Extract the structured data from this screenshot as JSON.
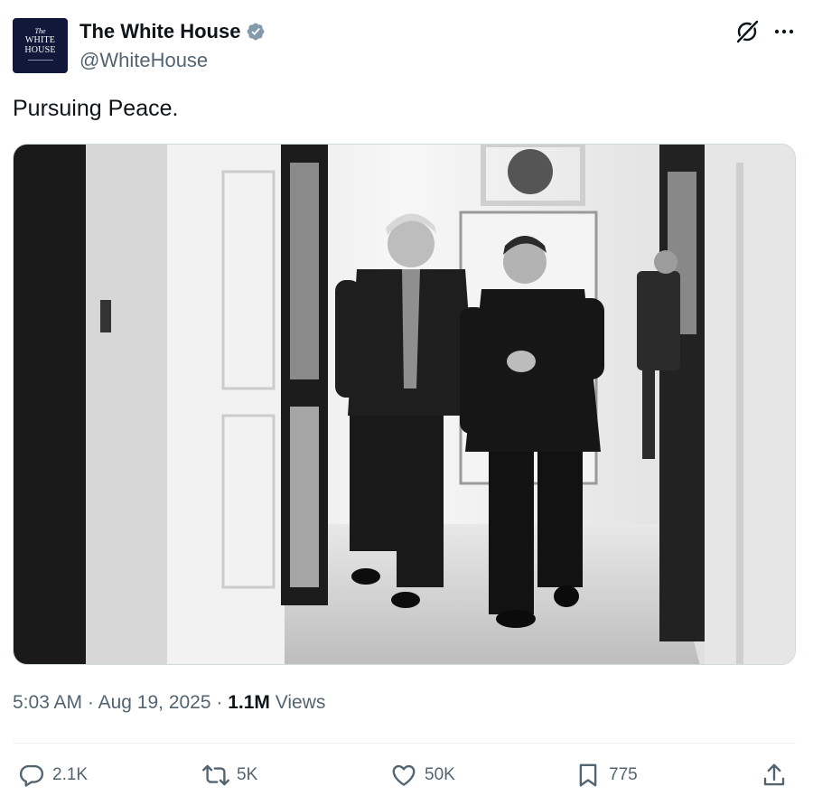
{
  "avatar": {
    "line1": "The",
    "line2": "WHITE",
    "line3": "HOUSE"
  },
  "author": {
    "display_name": "The White House",
    "handle": "@WhiteHouse"
  },
  "tweet": {
    "text": "Pursuing Peace."
  },
  "meta": {
    "time": "5:03 AM",
    "date": "Aug 19, 2025",
    "views_count": "1.1M",
    "views_label": "Views",
    "separator": "·"
  },
  "actions": {
    "replies": "2.1K",
    "reposts": "5K",
    "likes": "50K",
    "bookmarks": "775"
  },
  "icons": [
    "verified-badge-icon",
    "grok-icon",
    "more-icon",
    "reply-icon",
    "repost-icon",
    "like-icon",
    "bookmark-icon",
    "share-icon"
  ],
  "colors": {
    "text": "#0f1419",
    "secondary": "#536471",
    "verified": "#829aab",
    "avatar_bg": "#12183a"
  }
}
